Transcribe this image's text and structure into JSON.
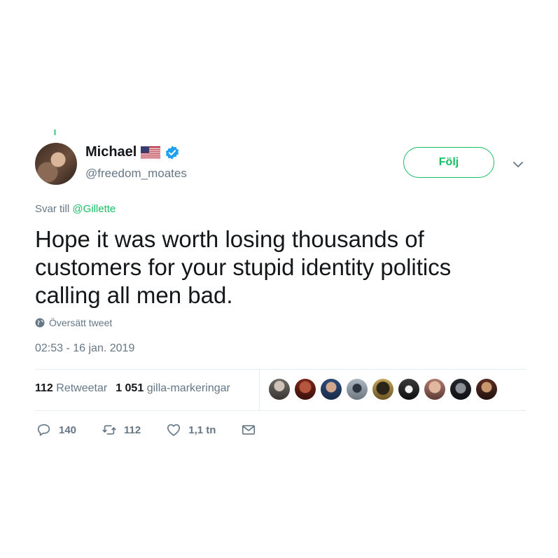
{
  "user": {
    "name": "Michael",
    "handle": "@freedom_moates",
    "flag_icon": "us-flag-icon",
    "verified_icon": "verified-badge-icon"
  },
  "follow_button": {
    "label": "Följ"
  },
  "reply": {
    "prefix": "Svar till",
    "mention": "@Gillette"
  },
  "tweet_text": "Hope it was worth losing thousands of customers for your stupid identity politics calling all men bad.",
  "translate_label": "Översätt tweet",
  "timestamp": "02:53 - 16 jan. 2019",
  "stats": {
    "retweets_count": "112",
    "retweets_label": "Retweetar",
    "likes_count": "1 051",
    "likes_label": "gilla-markeringar"
  },
  "actions": {
    "reply_count": "140",
    "retweet_count": "112",
    "like_count": "1,1 tn"
  },
  "colors": {
    "accent": "#17bf63",
    "text": "#14171a",
    "muted": "#657786",
    "divider": "#e6ecf0"
  }
}
